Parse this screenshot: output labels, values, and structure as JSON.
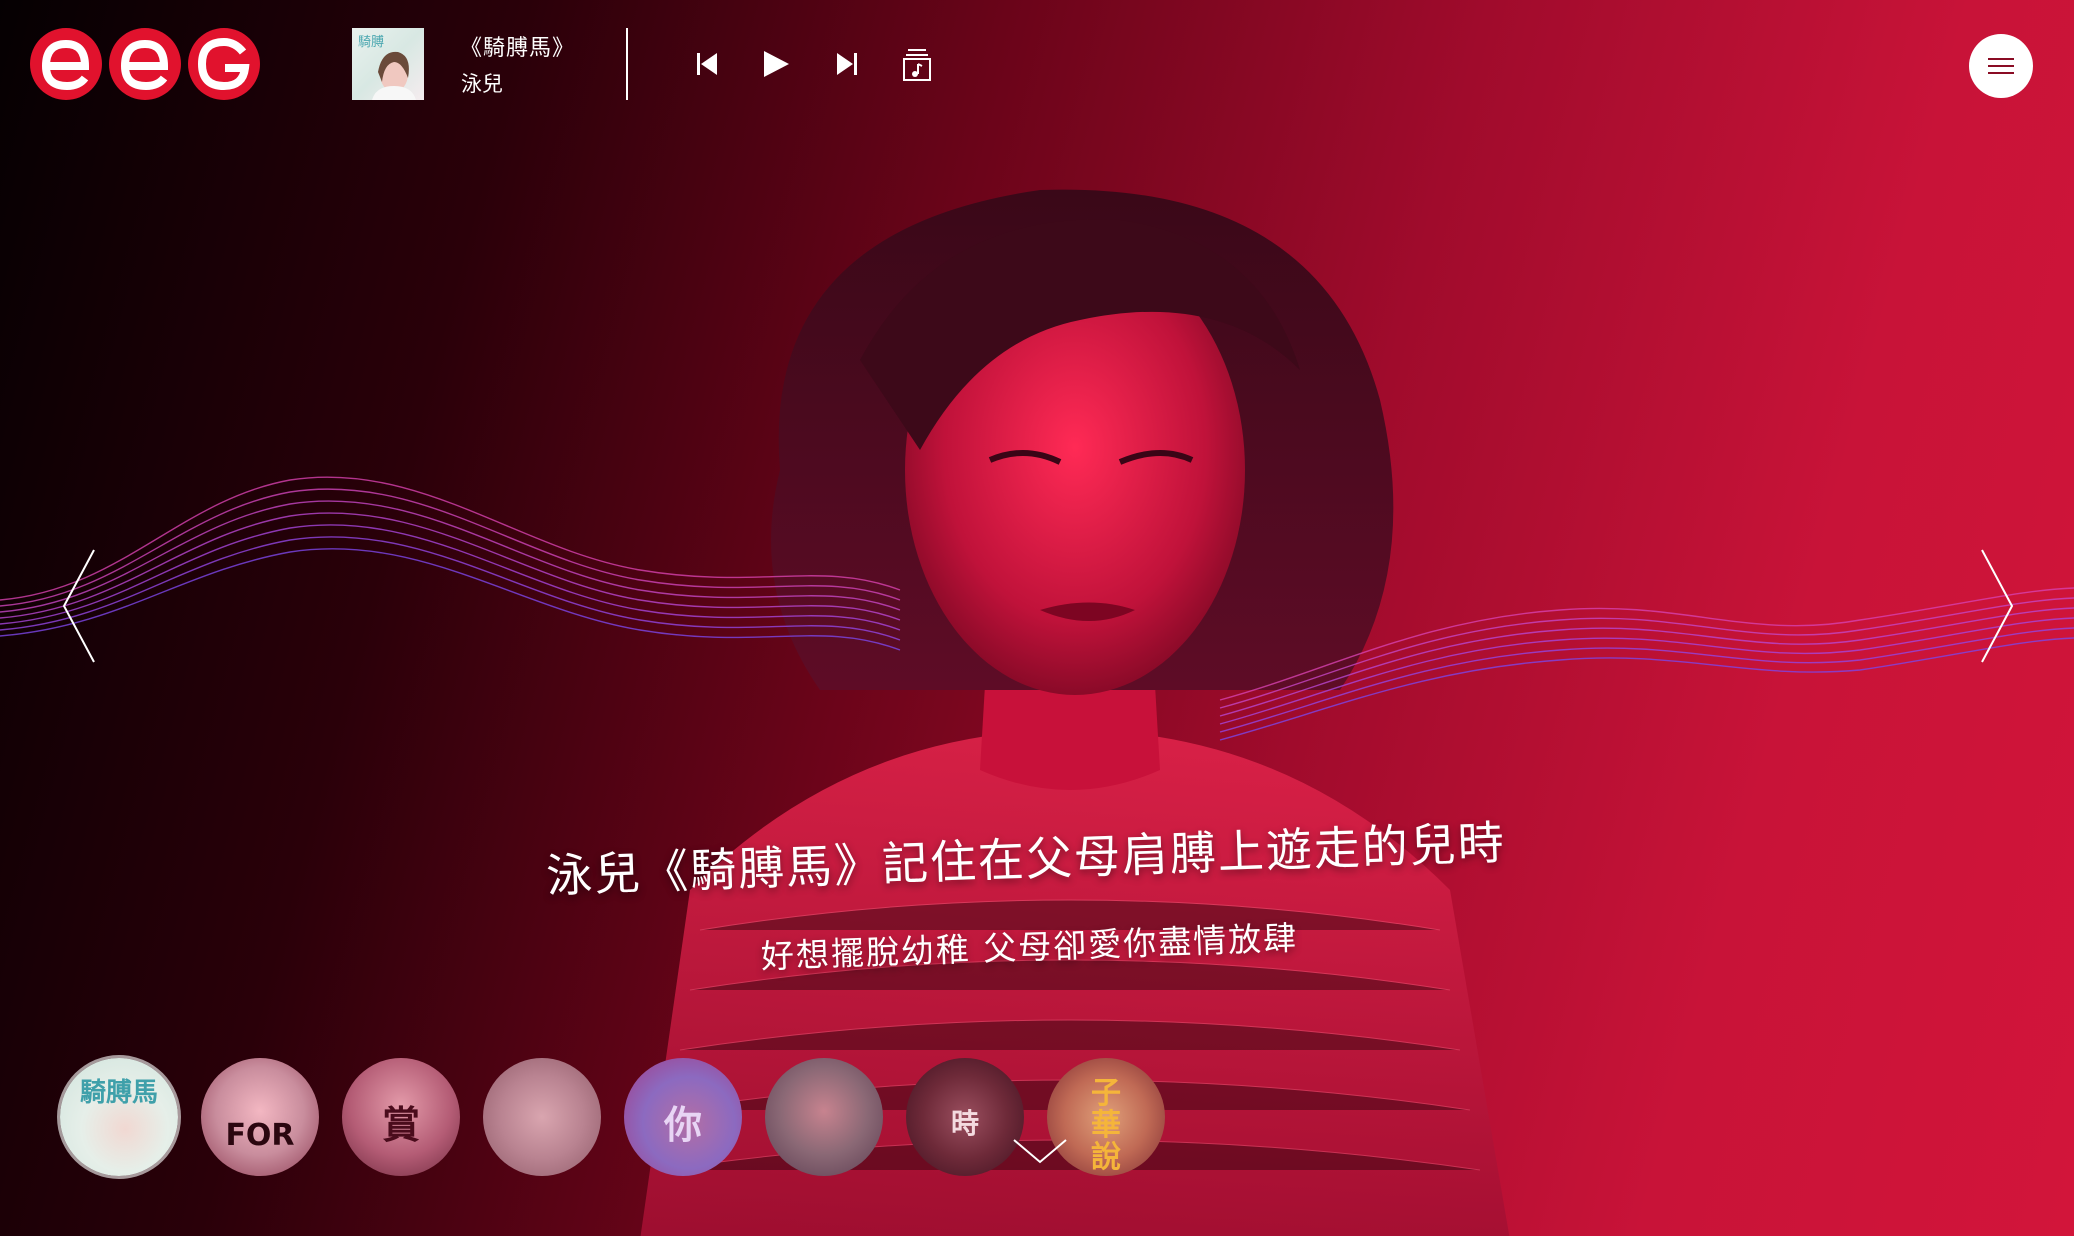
{
  "brand": {
    "logo_alt": "eeG",
    "accent": "#e1122d"
  },
  "player": {
    "track_title": "《騎膊馬》",
    "track_artist": "泳兒",
    "controls": [
      "previous-icon",
      "play-icon",
      "next-icon",
      "playlist-icon"
    ]
  },
  "menu": {
    "icon": "hamburger-icon",
    "color": "#ffffff"
  },
  "hero": {
    "headline": "泳兒《騎膊馬》記住在父母肩膊上遊走的兒時",
    "subline": "好想擺脫幼稚 父母卻愛你盡情放肆",
    "prev_icon": "chevron-left-icon",
    "next_icon": "chevron-right-icon",
    "background_colors": [
      "#050002",
      "#6a0419",
      "#d2153a"
    ],
    "wave_colors": [
      "#d742b0",
      "#7d46e8"
    ]
  },
  "carousel": {
    "items": [
      {
        "label": "騎膊馬",
        "active": true
      },
      {
        "label": "FOR",
        "active": false
      },
      {
        "label": "賞",
        "active": false
      },
      {
        "label": "",
        "active": false
      },
      {
        "label": "你",
        "active": false
      },
      {
        "label": "",
        "active": false
      },
      {
        "label": "時",
        "active": false
      },
      {
        "label": "子華說",
        "active": false
      }
    ],
    "scroll_icon": "chevron-down-icon"
  }
}
